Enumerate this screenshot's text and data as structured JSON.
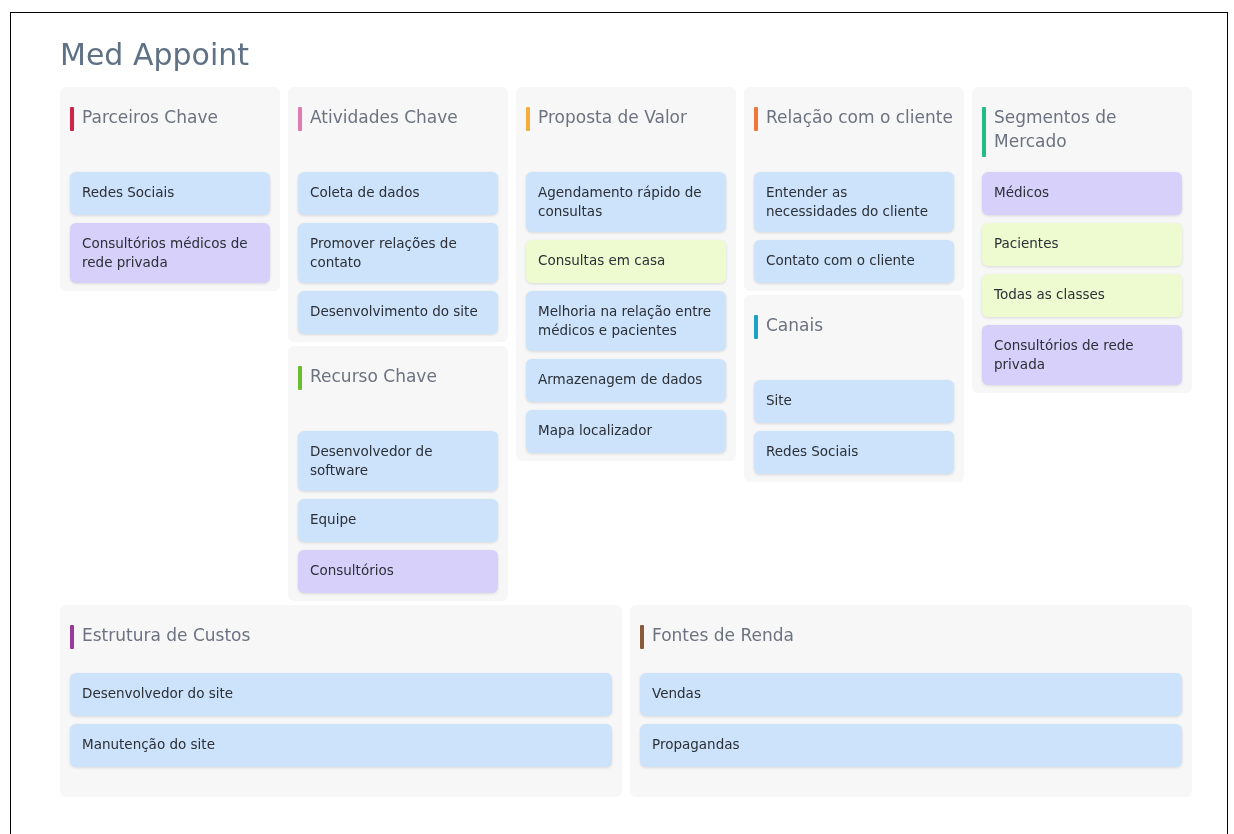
{
  "title": "Med Appoint",
  "columns": [
    {
      "sections": [
        {
          "heading": "Parceiros Chave",
          "color": "#d0234a",
          "notes": [
            {
              "text": "Redes Sociais",
              "color": "#cce3fb"
            },
            {
              "text": "Consultórios médicos de rede privada",
              "color": "#d6d0fb"
            }
          ]
        }
      ]
    },
    {
      "sections": [
        {
          "heading": "Atividades Chave",
          "color": "#e07bb0",
          "notes": [
            {
              "text": "Coleta de dados",
              "color": "#cce3fb"
            },
            {
              "text": "Promover relações de contato",
              "color": "#cce3fb"
            },
            {
              "text": "Desenvolvimento do site",
              "color": "#cce3fb"
            }
          ]
        },
        {
          "heading": "Recurso Chave",
          "color": "#6abf2e",
          "notes": [
            {
              "text": "Desenvolvedor de software",
              "color": "#cce3fb"
            },
            {
              "text": "Equipe",
              "color": "#cce3fb"
            },
            {
              "text": "Consultórios",
              "color": "#d6d0fb"
            }
          ]
        }
      ]
    },
    {
      "sections": [
        {
          "heading": "Proposta de Valor",
          "color": "#f5ad3c",
          "notes": [
            {
              "text": "Agendamento rápido de consultas",
              "color": "#cce3fb"
            },
            {
              "text": "Consultas em casa",
              "color": "#eefbd0"
            },
            {
              "text": "Melhoria na relação entre médicos e pacientes",
              "color": "#cce3fb"
            },
            {
              "text": "Armazenagem de dados",
              "color": "#cce3fb"
            },
            {
              "text": "Mapa localizador",
              "color": "#cce3fb"
            }
          ]
        }
      ]
    },
    {
      "sections": [
        {
          "heading": "Relação com o cliente",
          "color": "#f0763a",
          "notes": [
            {
              "text": "Entender as necessidades do cliente",
              "color": "#cce3fb"
            },
            {
              "text": "Contato com o cliente",
              "color": "#cce3fb"
            }
          ]
        },
        {
          "heading": "Canais",
          "color": "#1ca3c4",
          "notes": [
            {
              "text": "Site",
              "color": "#cce3fb"
            },
            {
              "text": "Redes Sociais",
              "color": "#cce3fb"
            }
          ]
        }
      ]
    },
    {
      "sections": [
        {
          "heading": "Segmentos de Mercado",
          "color": "#1fbf86",
          "notes": [
            {
              "text": "Médicos",
              "color": "#d6d0fb"
            },
            {
              "text": "Pacientes",
              "color": "#eefbd0"
            },
            {
              "text": "Todas as classes",
              "color": "#eefbd0"
            },
            {
              "text": "Consultórios de rede privada",
              "color": "#d6d0fb"
            }
          ]
        }
      ]
    }
  ],
  "bottom": [
    {
      "heading": "Estrutura de Custos",
      "color": "#9b3a9b",
      "notes": [
        {
          "text": "Desenvolvedor do site",
          "color": "#cce3fb"
        },
        {
          "text": "Manutenção do site",
          "color": "#cce3fb"
        }
      ]
    },
    {
      "heading": "Fontes de Renda",
      "color": "#8a5a3a",
      "notes": [
        {
          "text": "Vendas",
          "color": "#cce3fb"
        },
        {
          "text": "Propagandas",
          "color": "#cce3fb"
        }
      ]
    }
  ]
}
